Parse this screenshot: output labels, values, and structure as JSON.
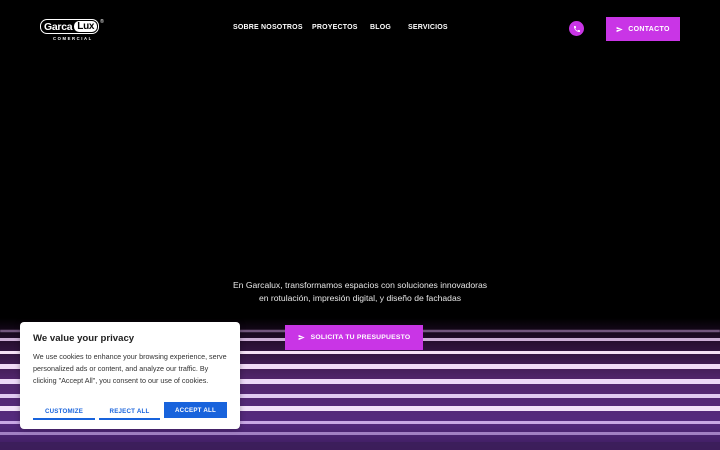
{
  "brand": {
    "logo_left": "Garca",
    "logo_right": "Lux",
    "logo_mark": "®",
    "logo_sub": "COMERCIAL"
  },
  "nav": {
    "items": [
      "SOBRE NOSOTROS",
      "PROYECTOS",
      "BLOG",
      "SERVICIOS"
    ]
  },
  "header": {
    "contact_label": "CONTACTO",
    "phone_icon": "phone-icon",
    "send_icon": "paper-plane-icon"
  },
  "hero": {
    "line1": "En Garcalux, transformamos espacios con soluciones innovadoras",
    "line2": "en rotulación, impresión digital, y diseño de fachadas",
    "cta_label": "SOLICITA TU PRESUPUESTO"
  },
  "cookie": {
    "title": "We value your privacy",
    "text": "We use cookies to enhance your browsing experience, serve personalized ads or content, and analyze our traffic. By clicking \"Accept All\", you consent to our use of cookies.",
    "customize": "CUSTOMIZE",
    "reject": "REJECT ALL",
    "accept": "ACCEPT ALL"
  },
  "colors": {
    "accent": "#c935e6",
    "cookie_blue": "#1863dc",
    "background": "#000000"
  }
}
